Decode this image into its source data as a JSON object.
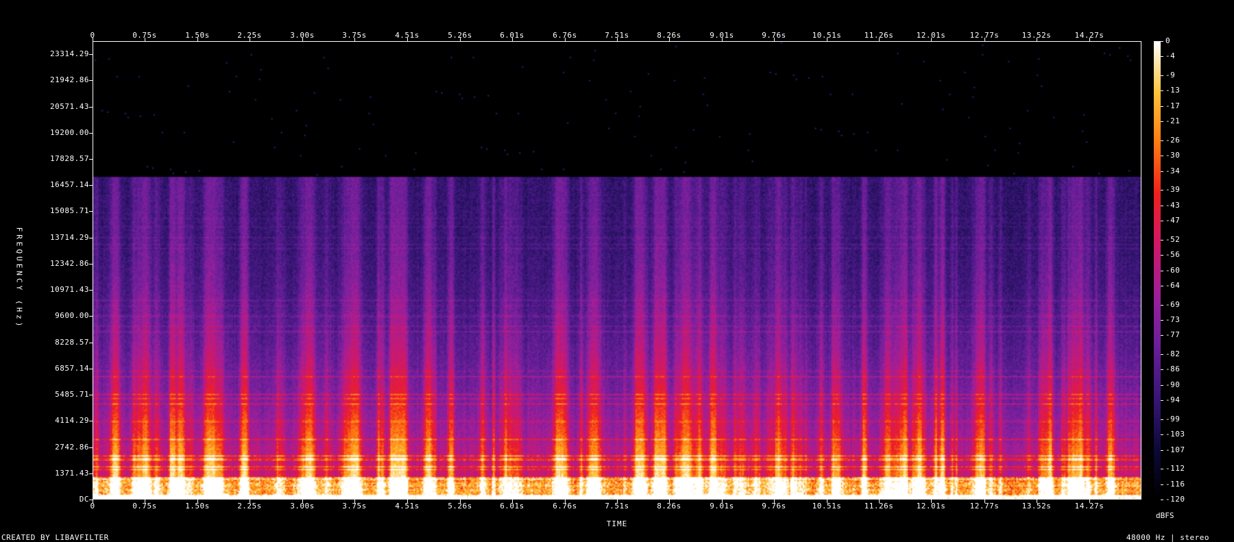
{
  "chart_data": {
    "type": "heatmap",
    "subtype": "spectrogram",
    "x_ticks": [
      "0",
      "0.75s",
      "1.50s",
      "2.25s",
      "3.00s",
      "3.75s",
      "4.51s",
      "5.26s",
      "6.01s",
      "6.76s",
      "7.51s",
      "8.26s",
      "9.01s",
      "9.76s",
      "10.51s",
      "11.26s",
      "12.01s",
      "12.77s",
      "13.52s",
      "14.27s"
    ],
    "x_tick_values": [
      0,
      0.75,
      1.5,
      2.25,
      3.0,
      3.75,
      4.51,
      5.26,
      6.01,
      6.76,
      7.51,
      8.26,
      9.01,
      9.76,
      10.51,
      11.26,
      12.01,
      12.77,
      13.52,
      14.27
    ],
    "x_range": [
      0,
      15.02
    ],
    "y_ticks": [
      "DC",
      "1371.43",
      "2742.86",
      "4114.29",
      "5485.71",
      "6857.14",
      "8228.57",
      "9600.00",
      "10971.43",
      "12342.86",
      "13714.29",
      "15085.71",
      "16457.14",
      "17828.57",
      "19200.00",
      "20571.43",
      "21942.86",
      "23314.29"
    ],
    "y_tick_values": [
      0,
      1371.43,
      2742.86,
      4114.29,
      5485.71,
      6857.14,
      8228.57,
      9600.0,
      10971.43,
      12342.86,
      13714.29,
      15085.71,
      16457.14,
      17828.57,
      19200.0,
      20571.43,
      21942.86,
      23314.29
    ],
    "y_range": [
      0,
      24000
    ],
    "energy_cutoff_hz": 16900,
    "colorbar_ticks": [
      "0",
      "-4",
      "-9",
      "-13",
      "-17",
      "-21",
      "-26",
      "-30",
      "-34",
      "-39",
      "-43",
      "-47",
      "-52",
      "-56",
      "-60",
      "-64",
      "-69",
      "-73",
      "-77",
      "-82",
      "-86",
      "-90",
      "-94",
      "-99",
      "-103",
      "-107",
      "-112",
      "-116",
      "-120"
    ],
    "colorbar_range": [
      0,
      -120
    ],
    "colorbar_unit": "dBFS",
    "xlabel": "TIME",
    "ylabel": "FREQUENCY (Hz)",
    "colormap": [
      "#000000",
      "#0d0a3a",
      "#3a1678",
      "#6a1f9a",
      "#9e1f9a",
      "#d0186a",
      "#ef2020",
      "#ff7a10",
      "#ffc43a",
      "#ffffff"
    ]
  },
  "footer": {
    "credit": "CREATED BY LIBAVFILTER",
    "sample_info": "48000 Hz | stereo"
  }
}
